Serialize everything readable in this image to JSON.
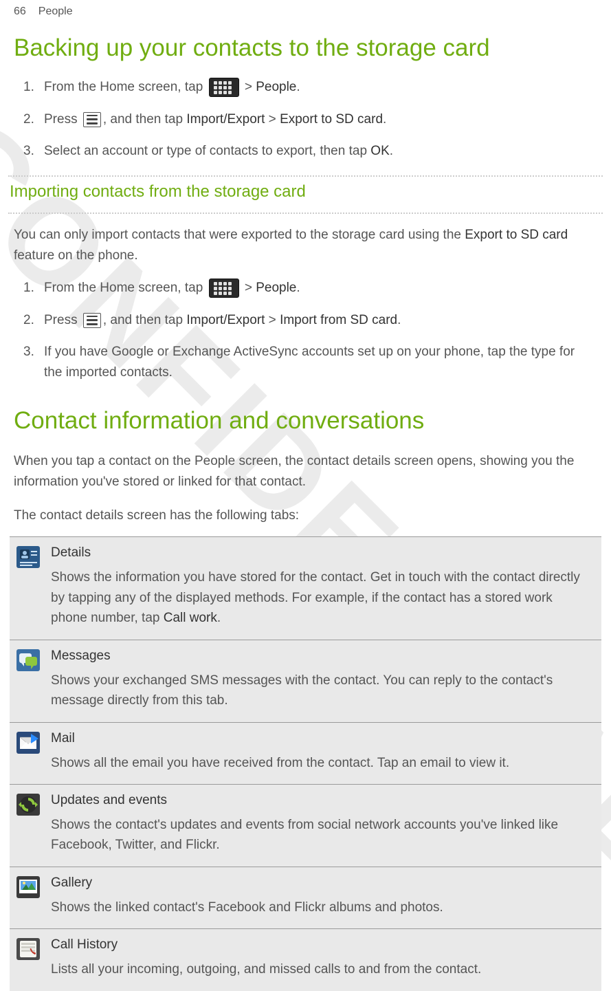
{
  "header": {
    "page_number": "66",
    "section": "People"
  },
  "h1_backup": "Backing up your contacts to the storage card",
  "steps_export": [
    {
      "prefix": "From the Home screen, tap ",
      "mid": " > ",
      "bold1": "People",
      "suffix": "."
    },
    {
      "prefix": "Press ",
      "mid": ", and then tap ",
      "bold1": "Import/Export",
      "sep": " > ",
      "bold2": "Export to SD card",
      "suffix": "."
    },
    {
      "text": "Select an account or type of contacts to export, then tap ",
      "bold1": "OK",
      "suffix": "."
    }
  ],
  "h2_import": "Importing contacts from the storage card",
  "import_intro_a": "You can only import contacts that were exported to the storage card using the ",
  "import_intro_bold": "Export to SD card",
  "import_intro_b": " feature on the phone.",
  "steps_import": [
    {
      "prefix": "From the Home screen, tap ",
      "mid": " > ",
      "bold1": "People",
      "suffix": "."
    },
    {
      "prefix": "Press ",
      "mid": ", and then tap ",
      "bold1": "Import/Export",
      "sep": " > ",
      "bold2": "Import from SD card",
      "suffix": "."
    },
    {
      "text": "If you have Google or Exchange ActiveSync accounts set up on your phone, tap the type for the imported contacts."
    }
  ],
  "h1_contact": "Contact information and conversations",
  "contact_p1": "When you tap a contact on the People screen, the contact details screen opens, showing you the information you've stored or linked for that contact.",
  "contact_p2": "The contact details screen has the following tabs:",
  "tabs": {
    "details": {
      "title": "Details",
      "desc_a": "Shows the information you have stored for the contact. Get in touch with the contact directly by tapping any of the displayed methods. For example, if the contact has a stored work phone number, tap ",
      "desc_bold": "Call work",
      "desc_b": "."
    },
    "messages": {
      "title": "Messages",
      "desc": "Shows your exchanged SMS messages with the contact. You can reply to the contact's message directly from this tab."
    },
    "mail": {
      "title": "Mail",
      "desc": "Shows all the email you have received from the contact. Tap an email to view it."
    },
    "updates": {
      "title": "Updates and events",
      "desc": "Shows the contact's updates and events from social network accounts you've linked like Facebook, Twitter, and Flickr."
    },
    "gallery": {
      "title": "Gallery",
      "desc": "Shows the linked contact's Facebook and Flickr albums and photos."
    },
    "call": {
      "title": "Call History",
      "desc": "Lists all your incoming, outgoing, and missed calls to and from the contact."
    }
  },
  "watermark": "CONFIDENTIAL"
}
